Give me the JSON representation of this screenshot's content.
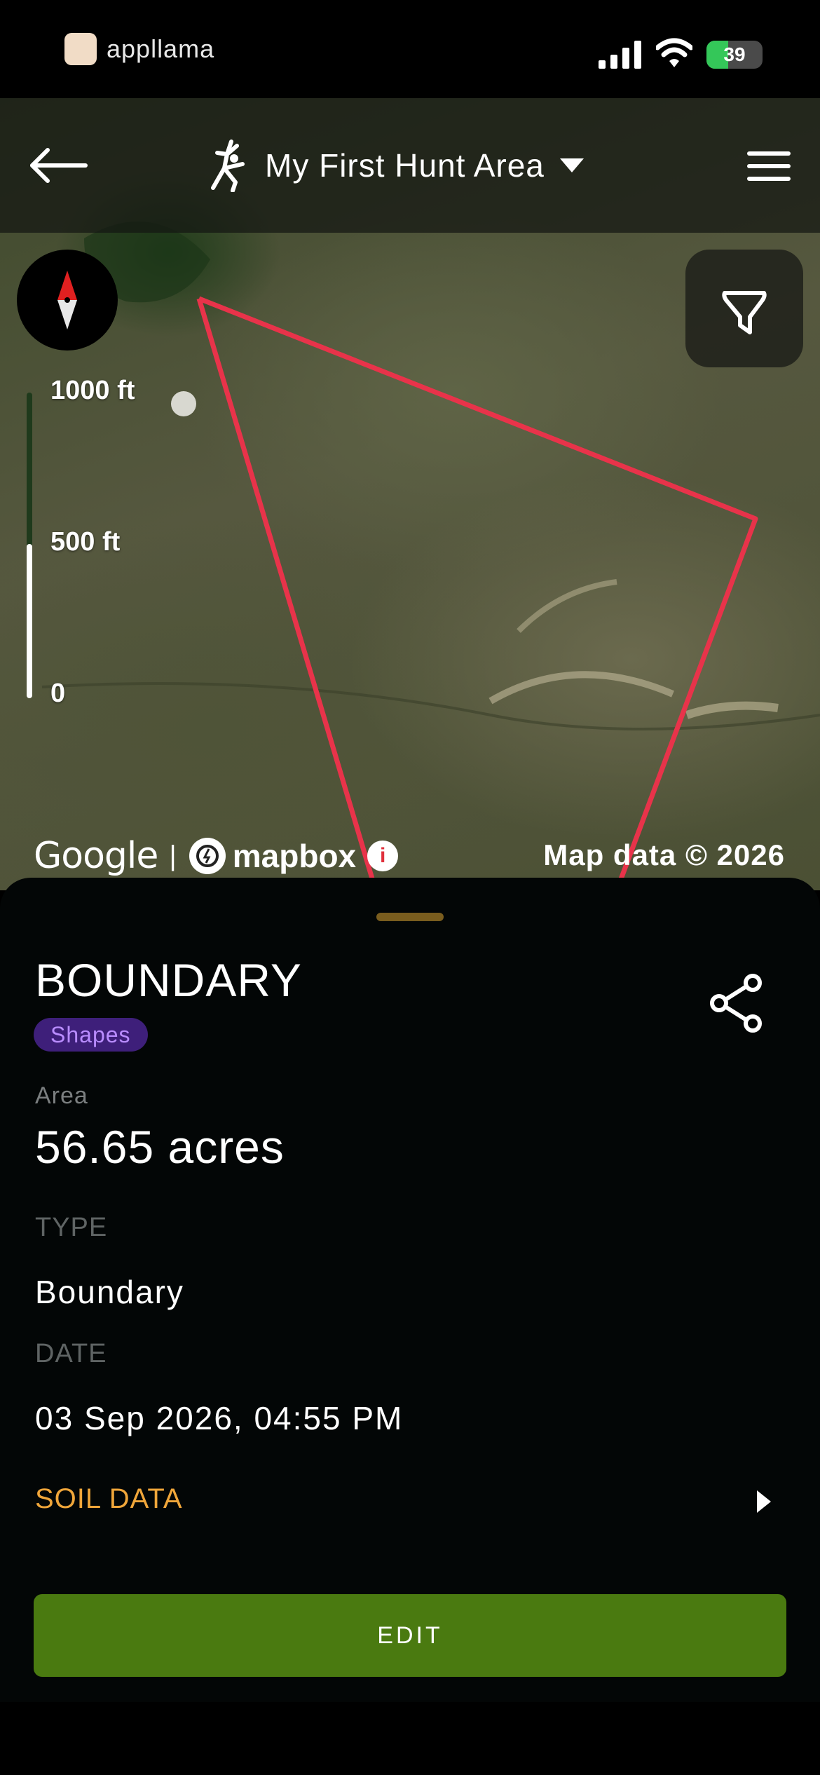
{
  "status_bar": {
    "carrier": "appllama",
    "battery": "39",
    "battery_level": 0.39,
    "colors": {
      "battery_fill": "#34c759"
    }
  },
  "header": {
    "title": "My First Hunt Area",
    "icons": {
      "back": "arrow-left-icon",
      "menu": "hamburger-menu-icon",
      "caret": "caret-down-icon",
      "logo": "hunter-logo-icon"
    }
  },
  "map": {
    "scale_labels": [
      "1000 ft",
      "500 ft",
      "0"
    ],
    "attribution": {
      "google": "Google",
      "separator": "|",
      "mapbox": "mapbox",
      "info": "i"
    },
    "map_data": "Map data © 2026",
    "boundary_color": "#e8334a",
    "icons": {
      "compass": "compass-icon",
      "filter": "filter-funnel-icon"
    }
  },
  "sheet": {
    "title": "BOUNDARY",
    "tag": "Shapes",
    "area_label": "Area",
    "area_value": "56.65 acres",
    "type_label": "TYPE",
    "type_value": "Boundary",
    "date_label": "DATE",
    "date_value": "03 Sep 2026, 04:55 PM",
    "soil_label": "SOIL DATA",
    "edit_label": "EDIT",
    "colors": {
      "accent": "#f0a63a",
      "tag_bg": "#3e1f7a",
      "tag_text": "#b98cff",
      "edit_bg": "#4a7a10"
    },
    "icons": {
      "share": "share-icon",
      "chevron": "chevron-right-icon"
    }
  }
}
